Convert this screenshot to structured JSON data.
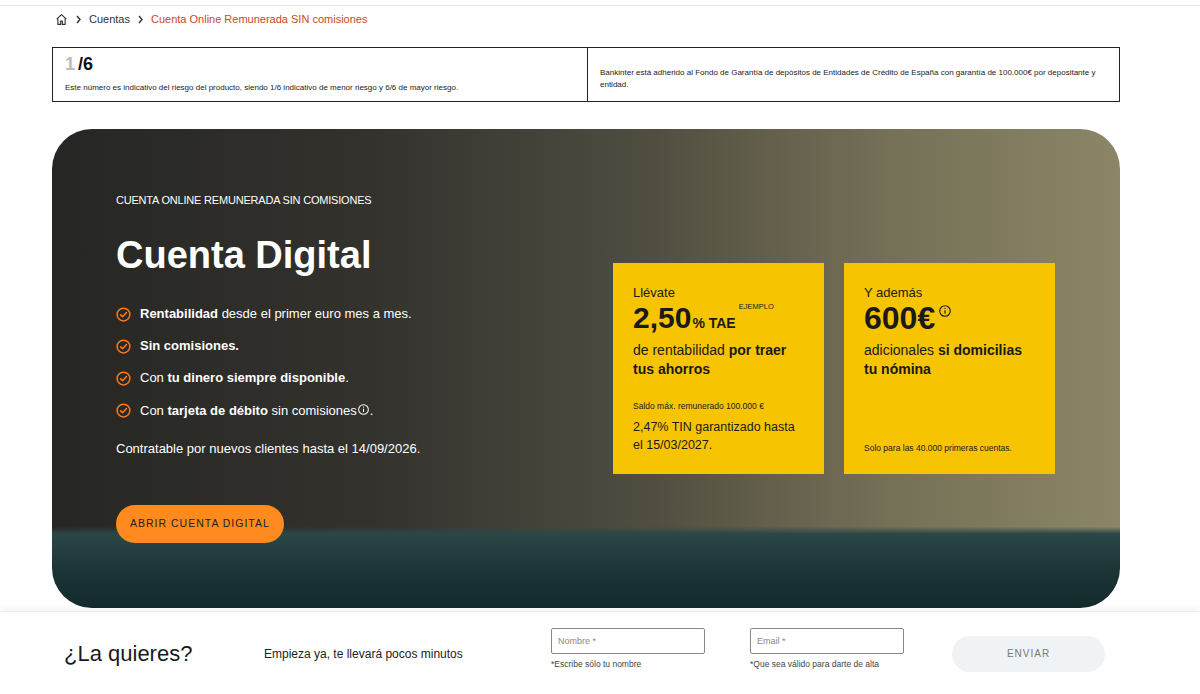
{
  "breadcrumb": {
    "items": [
      {
        "label": "Cuentas",
        "selected": false
      },
      {
        "label": "Cuenta Online Remunerada SIN comisiones",
        "selected": true
      }
    ]
  },
  "risk": {
    "value": "1",
    "scale": "/6",
    "note": "Este número es indicativo del riesgo del producto, siendo 1/6 indicativo de menor riesgo y 6/6 de mayor riesgo."
  },
  "guarantee": "Bankinter está adherido al Fondo de Garantía de depósitos de Entidades de Crédito de España con garantía de 100.000€ por depositante y entidad.",
  "hero": {
    "eyebrow": "CUENTA ONLINE REMUNERADA SIN COMISIONES",
    "title": "Cuenta Digital",
    "features": [
      {
        "parts": [
          {
            "kind": "text",
            "text": "Rentabilidad",
            "bold": true
          },
          {
            "kind": "text",
            "text": " desde el primer euro mes a mes.",
            "bold": false
          }
        ]
      },
      {
        "parts": [
          {
            "kind": "text",
            "text": "Sin comisiones.",
            "bold": true
          }
        ]
      },
      {
        "parts": [
          {
            "kind": "text",
            "text": "Con ",
            "bold": false
          },
          {
            "kind": "text",
            "text": "tu dinero siempre disponible",
            "bold": true
          },
          {
            "kind": "text",
            "text": ".",
            "bold": false
          }
        ]
      },
      {
        "parts": [
          {
            "kind": "text",
            "text": "Con ",
            "bold": false
          },
          {
            "kind": "text",
            "text": "tarjeta de débito",
            "bold": true
          },
          {
            "kind": "text",
            "text": " sin comisiones",
            "bold": false
          },
          {
            "kind": "info"
          },
          {
            "kind": "text",
            "text": ".",
            "bold": false
          }
        ]
      }
    ],
    "deadline": "Contratable por nuevos clientes hasta el 14/09/2026.",
    "button": "ABRIR CUENTA DIGITAL"
  },
  "offers": [
    {
      "kind": "rate",
      "label": "Llévate",
      "amount": "2,50",
      "unit": "% TAE",
      "tag": "EJEMPLO",
      "desc": [
        {
          "text": "de rentabilidad ",
          "bold": false
        },
        {
          "text": "por traer tus ahorros",
          "bold": true
        }
      ],
      "notes": [
        {
          "text": "Saldo máx. remunerado 100.000 €",
          "emphasis": false
        },
        {
          "text": "2,47% TIN garantizado hasta el 15/03/2027.",
          "emphasis": true
        }
      ]
    },
    {
      "kind": "bonus",
      "label": "Y además",
      "amount": "600€",
      "desc": [
        {
          "text": "adicionales ",
          "bold": false
        },
        {
          "text": "si domicilias tu nómina",
          "bold": true
        }
      ],
      "notes": [
        {
          "text": "Solo para las 40.000 primeras cuentas.",
          "emphasis": false
        }
      ]
    }
  ],
  "form": {
    "title": "¿La quieres?",
    "subtitle": "Empieza ya, te llevará pocos minutos",
    "fields": [
      {
        "placeholder": "Nombre *",
        "hint": "*Escribe sólo tu nombre"
      },
      {
        "placeholder": "Email *",
        "hint": "*Que sea válido para darte de alta"
      }
    ],
    "submit": {
      "label": "ENVIAR",
      "disabled": true
    }
  }
}
